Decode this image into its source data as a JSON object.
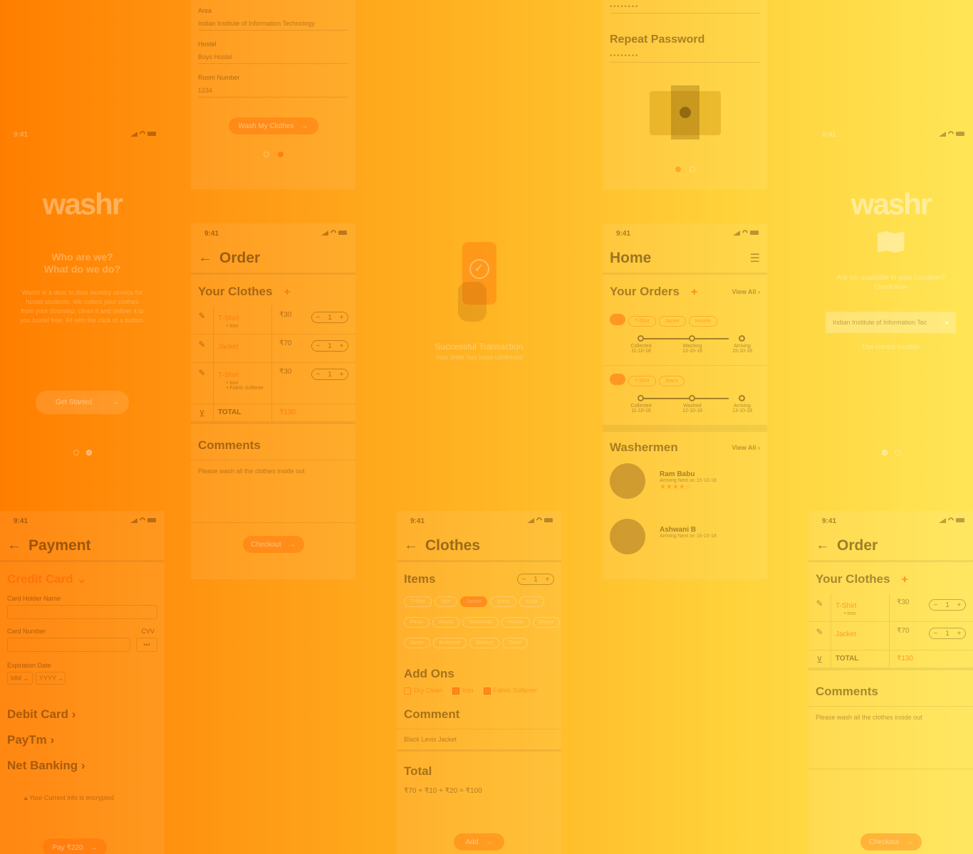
{
  "logo": "washr",
  "status_time": "9:41",
  "register_top": {
    "area_label": "Area",
    "area_value": "Indian Institute of Information Technology",
    "hostel_label": "Hostel",
    "hostel_value": "Boys Hostel",
    "room_label": "Room Number",
    "room_value": "1234",
    "cta": "Wash My Clothes"
  },
  "password_top": {
    "repeat_label": "Repeat Password"
  },
  "intro": {
    "heading": "Who are we?\nWhat do we do?",
    "body": "Washr is a door to door laundry service for hostel students. We collect your clothes from your doorstep, clean it and deliver it to you hostel free. All with the click of a button.",
    "cta": "Get Started"
  },
  "order": {
    "title": "Order",
    "section": "Your Clothes",
    "items": [
      {
        "name": "T-Shirt",
        "sub": "• Iron",
        "price": "₹30",
        "qty": "1"
      },
      {
        "name": "Jacket",
        "sub": "",
        "price": "₹70",
        "qty": "1"
      },
      {
        "name": "T-Shirt",
        "sub": "• Iron\n• Fabric Softener",
        "price": "₹30",
        "qty": "1"
      }
    ],
    "total_label": "TOTAL",
    "total_value": "₹130",
    "comments_title": "Comments",
    "comments_text": "Please wash all the clothes inside out",
    "checkout": "Checkout"
  },
  "success": {
    "title": "Successful Transaction",
    "sub": "Your order has been confirmed"
  },
  "home": {
    "title": "Home",
    "orders_title": "Your Orders",
    "view_all": "View All",
    "order1_chips": [
      "T-Shirt",
      "Jacket",
      "Hoodie"
    ],
    "order1_steps": [
      {
        "label": "Collected",
        "date": "11-10-18"
      },
      {
        "label": "Washing",
        "date": "13-10-18"
      },
      {
        "label": "Arriving",
        "date": "15-10-18"
      }
    ],
    "order2_chips": [
      "T-Shirt",
      "Jeans"
    ],
    "order2_steps": [
      {
        "label": "Collected",
        "date": "11-10-18"
      },
      {
        "label": "Washed",
        "date": "12-10-18"
      },
      {
        "label": "Arriving",
        "date": "13-10-18"
      }
    ],
    "washermen_title": "Washermen",
    "washermen_view_all": "View All",
    "washermen": [
      {
        "name": "Ram Babu",
        "sub": "Arriving Next on 15-10-18",
        "stars": "★★★★☆"
      },
      {
        "name": "Ashwani B",
        "sub": "Arriving Next on 16-10-18",
        "stars": ""
      }
    ]
  },
  "location": {
    "question": "Are we available in your Location?",
    "check": "Check Now",
    "input_value": "Indian Institute of Information Tec",
    "current": "Use current location"
  },
  "payment": {
    "title": "Payment",
    "credit": "Credit Card",
    "holder_label": "Card Holder Name",
    "number_label": "Card Number",
    "cvv_label": "CVV",
    "expiry_label": "Expiration Date",
    "month": "MM",
    "year": "YYYY",
    "debit": "Debit Card",
    "paytm": "PayTm",
    "netbanking": "Net Banking",
    "encrypted": "Your Current info is encrypted",
    "pay": "Pay ₹220"
  },
  "clothes": {
    "title": "Clothes",
    "items_title": "Items",
    "chips_row1": [
      "T-Shirt",
      "Shirt",
      "Jacket",
      "Jeans",
      "Kurta"
    ],
    "chips_row2": [
      "Pants",
      "Shorts",
      "Sweatshirt",
      "Hoodie",
      "Blazer"
    ],
    "chips_row3": [
      "Saree",
      "Bedsheet",
      "Blanket",
      "Towel"
    ],
    "addons_title": "Add Ons",
    "addons": [
      "Dry Clean",
      "Iron",
      "Fabric Softener"
    ],
    "comment_title": "Comment",
    "comment_value": "Black Levis Jacket",
    "total_title": "Total",
    "total_expr": "₹70 + ₹10 + ₹20 = ₹100",
    "add": "Add"
  },
  "order2": {
    "title": "Order",
    "section": "Your Clothes",
    "items": [
      {
        "name": "T-Shirt",
        "sub": "• Iron",
        "price": "₹30",
        "qty": "1"
      },
      {
        "name": "Jacket",
        "sub": "",
        "price": "₹70",
        "qty": "1"
      }
    ],
    "total_label": "TOTAL",
    "total_value": "₹130",
    "comments_title": "Comments",
    "comments_text": "Please wash all the clothes inside out",
    "checkout": "Checkout"
  },
  "colors": {
    "bg_start": "#ff7e00",
    "bg_end": "#ffe556",
    "accent": "#ff5a00"
  }
}
